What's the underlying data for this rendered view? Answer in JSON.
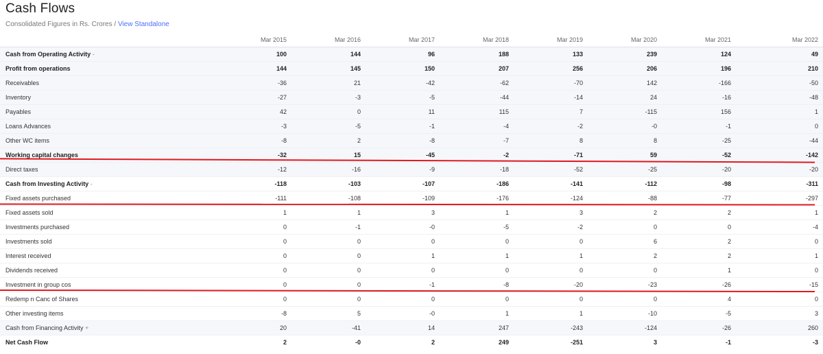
{
  "header": {
    "title": "Cash Flows",
    "subtitle": "Consolidated Figures in Rs. Crores /",
    "view_link": "View Standalone"
  },
  "table": {
    "columns": [
      "",
      "Mar 2015",
      "Mar 2016",
      "Mar 2017",
      "Mar 2018",
      "Mar 2019",
      "Mar 2020",
      "Mar 2021",
      "Mar 2022"
    ],
    "rows": [
      {
        "label": "Cash from Operating Activity",
        "toggle": "-",
        "values": [
          "100",
          "144",
          "96",
          "188",
          "133",
          "239",
          "124",
          "49"
        ]
      },
      {
        "label": "Profit from operations",
        "values": [
          "144",
          "145",
          "150",
          "207",
          "256",
          "206",
          "196",
          "210"
        ]
      },
      {
        "label": "Receivables",
        "values": [
          "-36",
          "21",
          "-42",
          "-62",
          "-70",
          "142",
          "-166",
          "-50"
        ]
      },
      {
        "label": "Inventory",
        "values": [
          "-27",
          "-3",
          "-5",
          "-44",
          "-14",
          "24",
          "-16",
          "-48"
        ]
      },
      {
        "label": "Payables",
        "values": [
          "42",
          "0",
          "11",
          "115",
          "7",
          "-115",
          "156",
          "1"
        ]
      },
      {
        "label": "Loans Advances",
        "values": [
          "-3",
          "-5",
          "-1",
          "-4",
          "-2",
          "-0",
          "-1",
          "0"
        ]
      },
      {
        "label": "Other WC items",
        "values": [
          "-8",
          "2",
          "-8",
          "-7",
          "8",
          "8",
          "-25",
          "-44"
        ]
      },
      {
        "label": "Working capital changes",
        "values": [
          "-32",
          "15",
          "-45",
          "-2",
          "-71",
          "59",
          "-52",
          "-142"
        ]
      },
      {
        "label": "Direct taxes",
        "values": [
          "-12",
          "-16",
          "-9",
          "-18",
          "-52",
          "-25",
          "-20",
          "-20"
        ]
      },
      {
        "label": "Cash from Investing Activity",
        "toggle": "-",
        "values": [
          "-118",
          "-103",
          "-107",
          "-186",
          "-141",
          "-112",
          "-98",
          "-311"
        ]
      },
      {
        "label": "Fixed assets purchased",
        "values": [
          "-111",
          "-108",
          "-109",
          "-176",
          "-124",
          "-88",
          "-77",
          "-297"
        ]
      },
      {
        "label": "Fixed assets sold",
        "values": [
          "1",
          "1",
          "3",
          "1",
          "3",
          "2",
          "2",
          "1"
        ]
      },
      {
        "label": "Investments purchased",
        "values": [
          "0",
          "-1",
          "-0",
          "-5",
          "-2",
          "0",
          "0",
          "-4"
        ]
      },
      {
        "label": "Investments sold",
        "values": [
          "0",
          "0",
          "0",
          "0",
          "0",
          "6",
          "2",
          "0"
        ]
      },
      {
        "label": "Interest received",
        "values": [
          "0",
          "0",
          "1",
          "1",
          "1",
          "2",
          "2",
          "1"
        ]
      },
      {
        "label": "Dividends received",
        "values": [
          "0",
          "0",
          "0",
          "0",
          "0",
          "0",
          "1",
          "0"
        ]
      },
      {
        "label": "Investment in group cos",
        "values": [
          "0",
          "0",
          "-1",
          "-8",
          "-20",
          "-23",
          "-26",
          "-15"
        ]
      },
      {
        "label": "Redemp n Canc of Shares",
        "values": [
          "0",
          "0",
          "0",
          "0",
          "0",
          "0",
          "4",
          "0"
        ]
      },
      {
        "label": "Other investing items",
        "values": [
          "-8",
          "5",
          "-0",
          "1",
          "1",
          "-10",
          "-5",
          "3"
        ]
      },
      {
        "label": "Cash from Financing Activity",
        "toggle": "+",
        "values": [
          "20",
          "-41",
          "14",
          "247",
          "-243",
          "-124",
          "-26",
          "260"
        ]
      },
      {
        "label": "Net Cash Flow",
        "values": [
          "2",
          "-0",
          "2",
          "249",
          "-251",
          "3",
          "-1",
          "-3"
        ]
      }
    ]
  },
  "annotations": {
    "underline_color": "#e0191f"
  }
}
